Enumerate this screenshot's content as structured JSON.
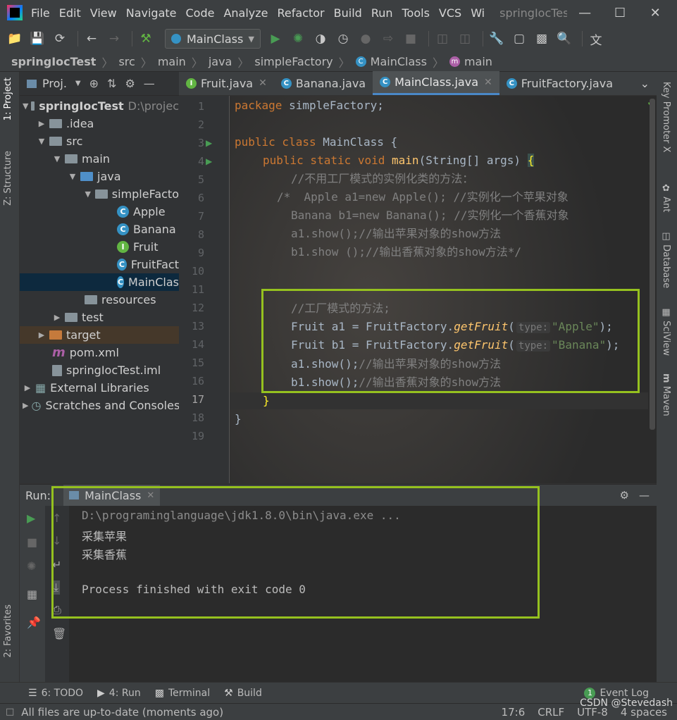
{
  "menubar": {
    "items": [
      "File",
      "Edit",
      "View",
      "Navigate",
      "Code",
      "Analyze",
      "Refactor",
      "Build",
      "Run",
      "Tools",
      "VCS",
      "Wi"
    ],
    "window_title": "springIocTes"
  },
  "toolbar": {
    "run_config": "MainClass"
  },
  "breadcrumb": [
    "springIocTest",
    "src",
    "main",
    "java",
    "simpleFactory",
    "MainClass",
    "main"
  ],
  "left_strip": {
    "project": "1: Project",
    "structure": "Z: Structure",
    "favorites": "2: Favorites"
  },
  "right_strip": [
    "Key Promoter X",
    "Ant",
    "Database",
    "SciView",
    "Maven"
  ],
  "project_panel": {
    "title": "Proj.",
    "tree": [
      {
        "label": "springIocTest",
        "extra": "D:\\projec",
        "kind": "module"
      },
      {
        "label": ".idea",
        "kind": "folder"
      },
      {
        "label": "src",
        "kind": "folder"
      },
      {
        "label": "main",
        "kind": "folder"
      },
      {
        "label": "java",
        "kind": "folder-blue"
      },
      {
        "label": "simpleFacto",
        "kind": "package"
      },
      {
        "label": "Apple",
        "kind": "class"
      },
      {
        "label": "Banana",
        "kind": "class"
      },
      {
        "label": "Fruit",
        "kind": "interface"
      },
      {
        "label": "FruitFact",
        "kind": "class"
      },
      {
        "label": "MainClas",
        "kind": "class"
      },
      {
        "label": "resources",
        "kind": "folder"
      },
      {
        "label": "test",
        "kind": "folder"
      },
      {
        "label": "target",
        "kind": "folder-orange"
      },
      {
        "label": "pom.xml",
        "kind": "maven"
      },
      {
        "label": "springIocTest.iml",
        "kind": "file"
      },
      {
        "label": "External Libraries",
        "kind": "lib"
      },
      {
        "label": "Scratches and Consoles",
        "kind": "scratch"
      }
    ]
  },
  "editor": {
    "tabs": [
      "Fruit.java",
      "Banana.java",
      "MainClass.java",
      "FruitFactory.java"
    ],
    "active_tab": "MainClass.java",
    "line_numbers": [
      "1",
      "2",
      "3",
      "4",
      "5",
      "6",
      "7",
      "8",
      "9",
      "10",
      "11",
      "12",
      "13",
      "14",
      "15",
      "16",
      "17",
      "18",
      "19"
    ],
    "code": {
      "l1_kw": "package",
      "l1_rest": " simpleFactory;",
      "l3_kw": "public class",
      "l3_rest": " MainClass {",
      "l4_kw": "public static void",
      "l4_fn": "main",
      "l4_rest": "(String[] args) ",
      "l4_brace": "{",
      "l5": "//不用工厂模式的实例化类的方法：",
      "l6": "/*  Apple a1=new Apple(); //实例化一个苹果对象",
      "l7": "Banana b1=new Banana(); //实例化一个香蕉对象",
      "l8": "a1.show();//输出苹果对象的show方法",
      "l9": "b1.show ();//输出香蕉对象的show方法*/",
      "l12": "//工厂模式的方法;",
      "l13_pre": "Fruit a1 = FruitFactory.",
      "l13_fn": "getFruit",
      "l13_hint": "type:",
      "l13_str": "\"Apple\"",
      "l13_end": ");",
      "l14_pre": "Fruit b1 = FruitFactory.",
      "l14_fn": "getFruit",
      "l14_hint": "type:",
      "l14_str": "\"Banana\"",
      "l14_end": ");",
      "l15_code": "a1.show();",
      "l15_cm": "//输出苹果对象的show方法",
      "l16_code": "b1.show();",
      "l16_cm": "//输出香蕉对象的show方法",
      "l17": "}",
      "l18": "}"
    }
  },
  "run_panel": {
    "label": "Run:",
    "tab": "MainClass",
    "output": [
      "D:\\programinglanguage\\jdk1.8.0\\bin\\java.exe ...",
      "采集苹果",
      "采集香蕉",
      "",
      "Process finished with exit code 0"
    ]
  },
  "bottom_tabs": {
    "todo": "6: TODO",
    "run": "4: Run",
    "terminal": "Terminal",
    "build": "Build",
    "event_log": "Event Log",
    "event_count": "1"
  },
  "status": {
    "message": "All files are up-to-date (moments ago)",
    "position": "17:6",
    "line_sep": "CRLF",
    "encoding": "UTF-8",
    "indent": "4 spaces",
    "watermark": "CSDN @Stevedash"
  },
  "colors": {
    "highlight_box": "#95c11f",
    "keyword": "#cc7832",
    "string": "#6a8759",
    "comment": "#808080"
  }
}
